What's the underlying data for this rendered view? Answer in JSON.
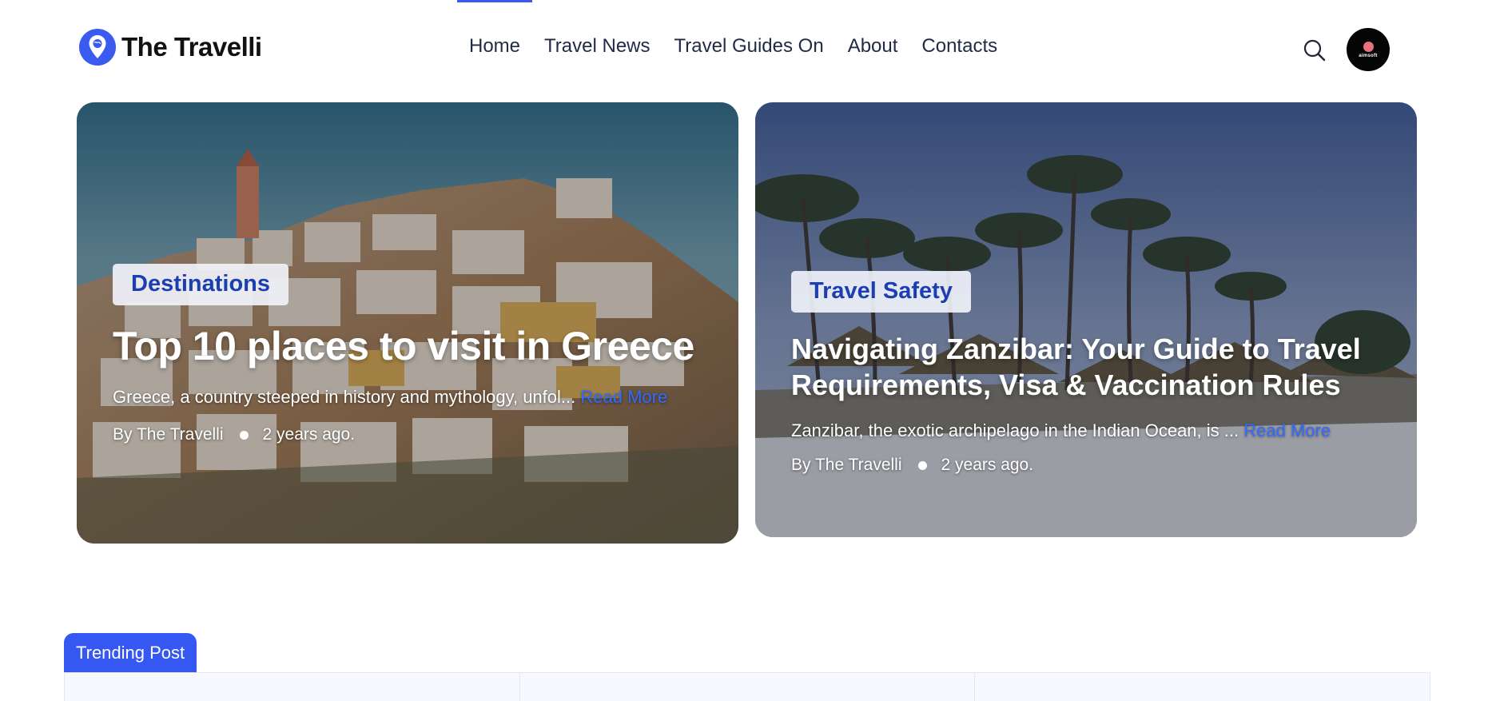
{
  "site": {
    "logo_text": "The Travelli",
    "logo_icon": "map-pin-globe-icon",
    "accent_color": "#3a5af0"
  },
  "nav": {
    "items": [
      {
        "label": "Home"
      },
      {
        "label": "Travel News"
      },
      {
        "label": "Travel Guides On"
      },
      {
        "label": "About"
      },
      {
        "label": "Contacts"
      }
    ]
  },
  "header_actions": {
    "search_icon": "search-icon",
    "avatar_text": "aimsoft"
  },
  "posts": [
    {
      "category": "Destinations",
      "title": "Top 10 places to visit in Greece",
      "excerpt": "Greece, a country steeped in history and mythology, unfol... ",
      "read_more": "Read More",
      "author": "By The Travelli",
      "time": "2 years ago."
    },
    {
      "category": "Travel Safety",
      "title": "Navigating Zanzibar: Your Guide to Travel Requirements, Visa & Vaccination Rules",
      "excerpt": "Zanzibar, the exotic archipelago in the Indian Ocean, is ... ",
      "read_more": "Read More",
      "author": "By The Travelli",
      "time": "2 years ago."
    }
  ],
  "trending": {
    "tab_label": "Trending Post"
  },
  "colors": {
    "badge_text": "#1b3fb0",
    "read_more": "#2f6bff",
    "trending_tab": "#3557f2"
  }
}
